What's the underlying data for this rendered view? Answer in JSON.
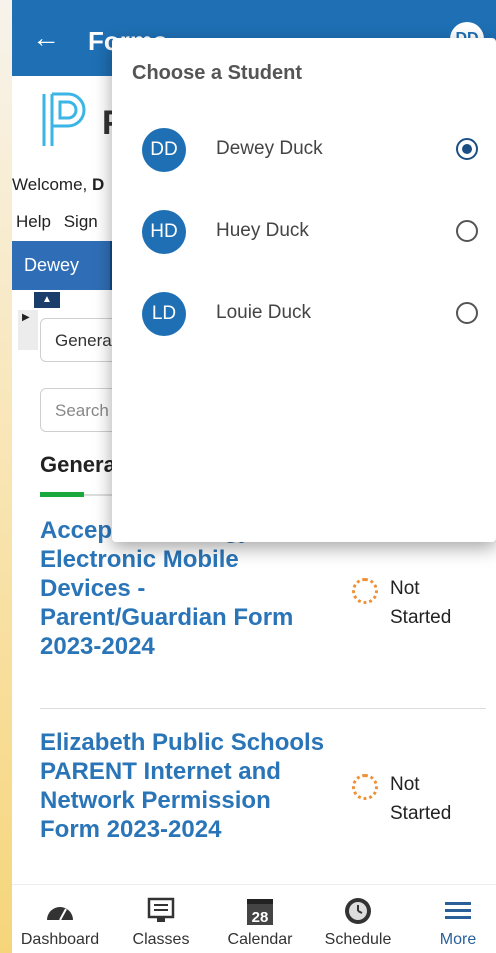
{
  "header": {
    "title": "Forms",
    "avatar_initials": "DD",
    "back_icon": "arrow-left-icon"
  },
  "brand": {
    "logo_letter": "P"
  },
  "welcome": {
    "prefix": "Welcome,",
    "name": "D"
  },
  "links": {
    "help": "Help",
    "sign": "Sign"
  },
  "student_tab": {
    "label": "Dewey"
  },
  "form_filter": {
    "selected": "Genera"
  },
  "search": {
    "placeholder": "Search"
  },
  "section": {
    "title": "Genera"
  },
  "forms": [
    {
      "title": "Accep Technology – Electronic Mobile Devices - Parent/Guardian Form 2023-2024",
      "status": "Not Started"
    },
    {
      "title": "Elizabeth Public Schools PARENT Internet and Network Permission Form 2023-2024",
      "status": "Not Started"
    }
  ],
  "popup": {
    "title": "Choose a Student",
    "students": [
      {
        "initials": "DD",
        "name": "Dewey Duck",
        "selected": true
      },
      {
        "initials": "HD",
        "name": "Huey Duck",
        "selected": false
      },
      {
        "initials": "LD",
        "name": "Louie Duck",
        "selected": false
      }
    ]
  },
  "bottom_nav": [
    {
      "label": "Dashboard",
      "icon": "speedometer-icon",
      "active": false
    },
    {
      "label": "Classes",
      "icon": "monitor-icon",
      "active": false
    },
    {
      "label": "Calendar",
      "icon": "calendar-icon",
      "badge": "28",
      "active": false
    },
    {
      "label": "Schedule",
      "icon": "clock-icon",
      "active": false
    },
    {
      "label": "More",
      "icon": "menu-icon",
      "active": true
    }
  ],
  "colors": {
    "primary": "#1e6fb4",
    "link": "#2a75b8",
    "status_orange": "#f09035",
    "tab_green": "#19a93c"
  }
}
